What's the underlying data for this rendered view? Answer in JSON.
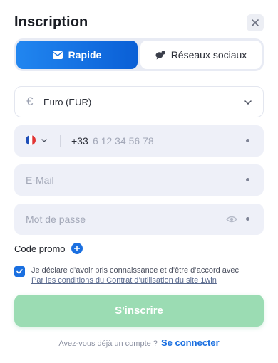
{
  "header": {
    "title": "Inscription",
    "close_icon": "close-icon"
  },
  "tabs": [
    {
      "label": "Rapide",
      "icon": "envelope-icon",
      "active": true
    },
    {
      "label": "Réseaux sociaux",
      "icon": "chat-bubbles-icon",
      "active": false
    }
  ],
  "currency": {
    "symbol": "€",
    "value": "Euro (EUR)",
    "icon": "chevron-down-icon"
  },
  "phone": {
    "country_flag": "france-flag-icon",
    "dial_code": "+33",
    "placeholder": "6 12 34 56 78"
  },
  "email": {
    "placeholder": "E-Mail"
  },
  "password": {
    "placeholder": "Mot de passe",
    "icon": "eye-icon"
  },
  "promo": {
    "label": "Code promo",
    "icon": "plus-icon"
  },
  "consent": {
    "checked": true,
    "text": "Je déclare d’avoir pris connaissance et d’être d’accord avec",
    "link": "Par les conditions du Contrat d’utilisation du site 1win"
  },
  "submit": {
    "label": "S'inscrire"
  },
  "footer": {
    "question": "Avez-vous déjà un compte ?",
    "login_link": "Se connecter"
  },
  "colors": {
    "accent": "#1a6fe0",
    "submit_disabled": "#9bdcb3",
    "field_bg": "#eef0f8"
  }
}
